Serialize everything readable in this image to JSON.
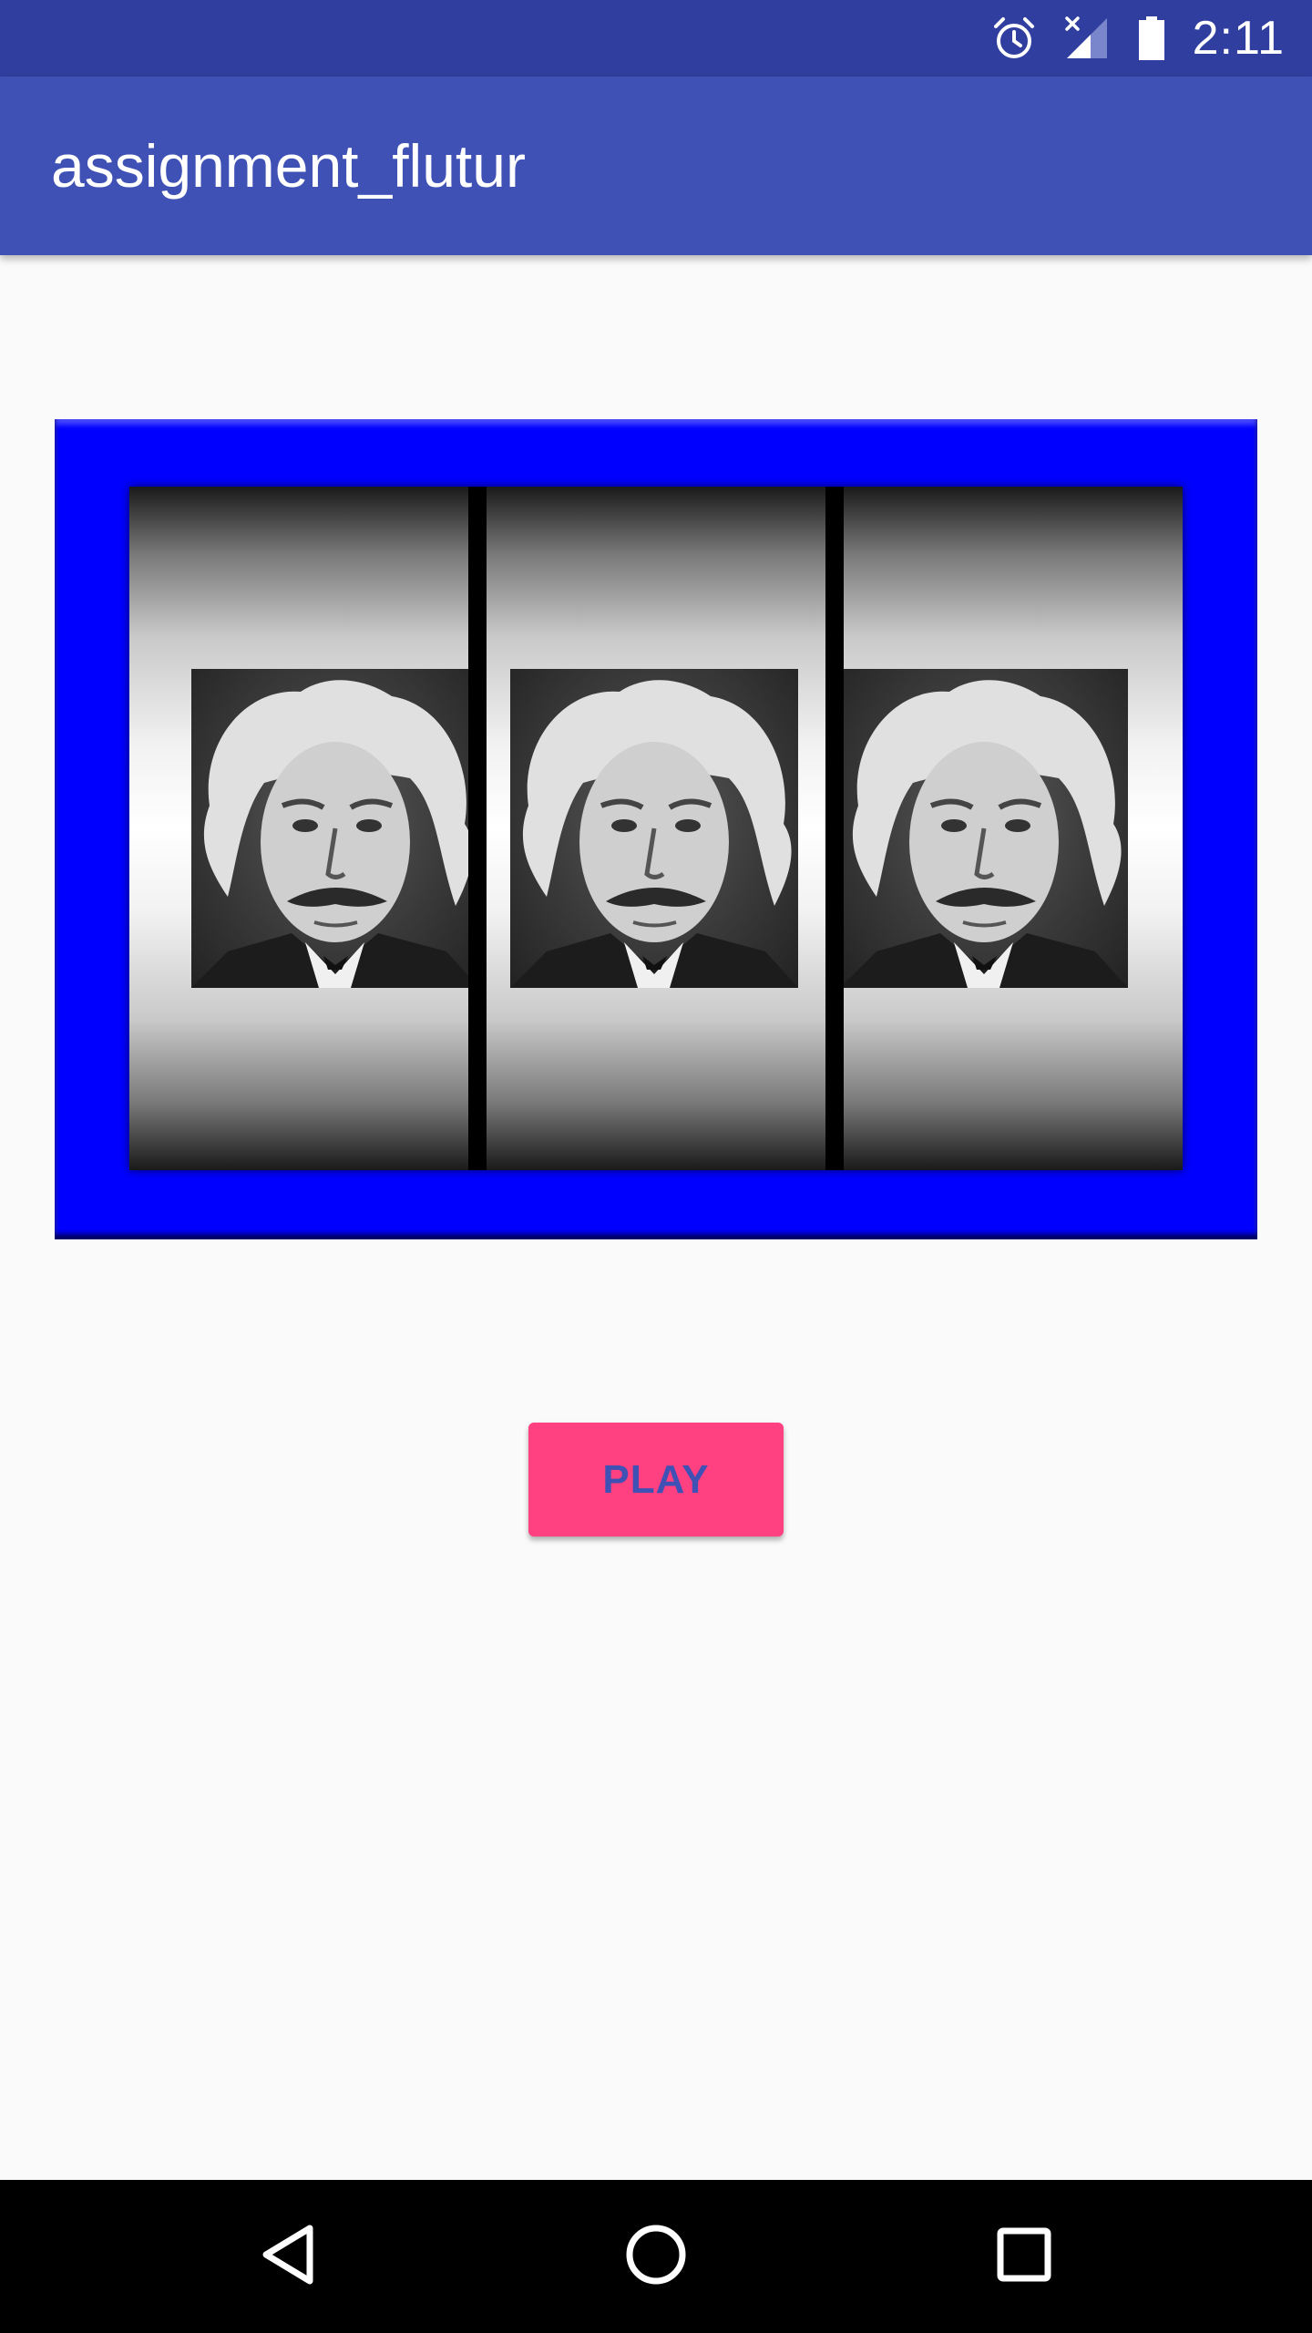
{
  "status_bar": {
    "time": "2:11",
    "icons": [
      "alarm-icon",
      "no-signal-icon",
      "battery-icon"
    ]
  },
  "app_bar": {
    "title": "assignment_flutur"
  },
  "slot_machine": {
    "reels": [
      {
        "image": "einstein-portrait"
      },
      {
        "image": "einstein-portrait"
      },
      {
        "image": "einstein-portrait"
      }
    ]
  },
  "play_button": {
    "label": "PLAY"
  },
  "nav_bar": {
    "buttons": [
      "back-icon",
      "home-icon",
      "recents-icon"
    ]
  },
  "colors": {
    "status_bar": "#303f9f",
    "app_bar": "#3f51b5",
    "frame": "#0000ff",
    "button": "#ff4081",
    "button_text": "#3f51b5",
    "background": "#fafafa"
  }
}
